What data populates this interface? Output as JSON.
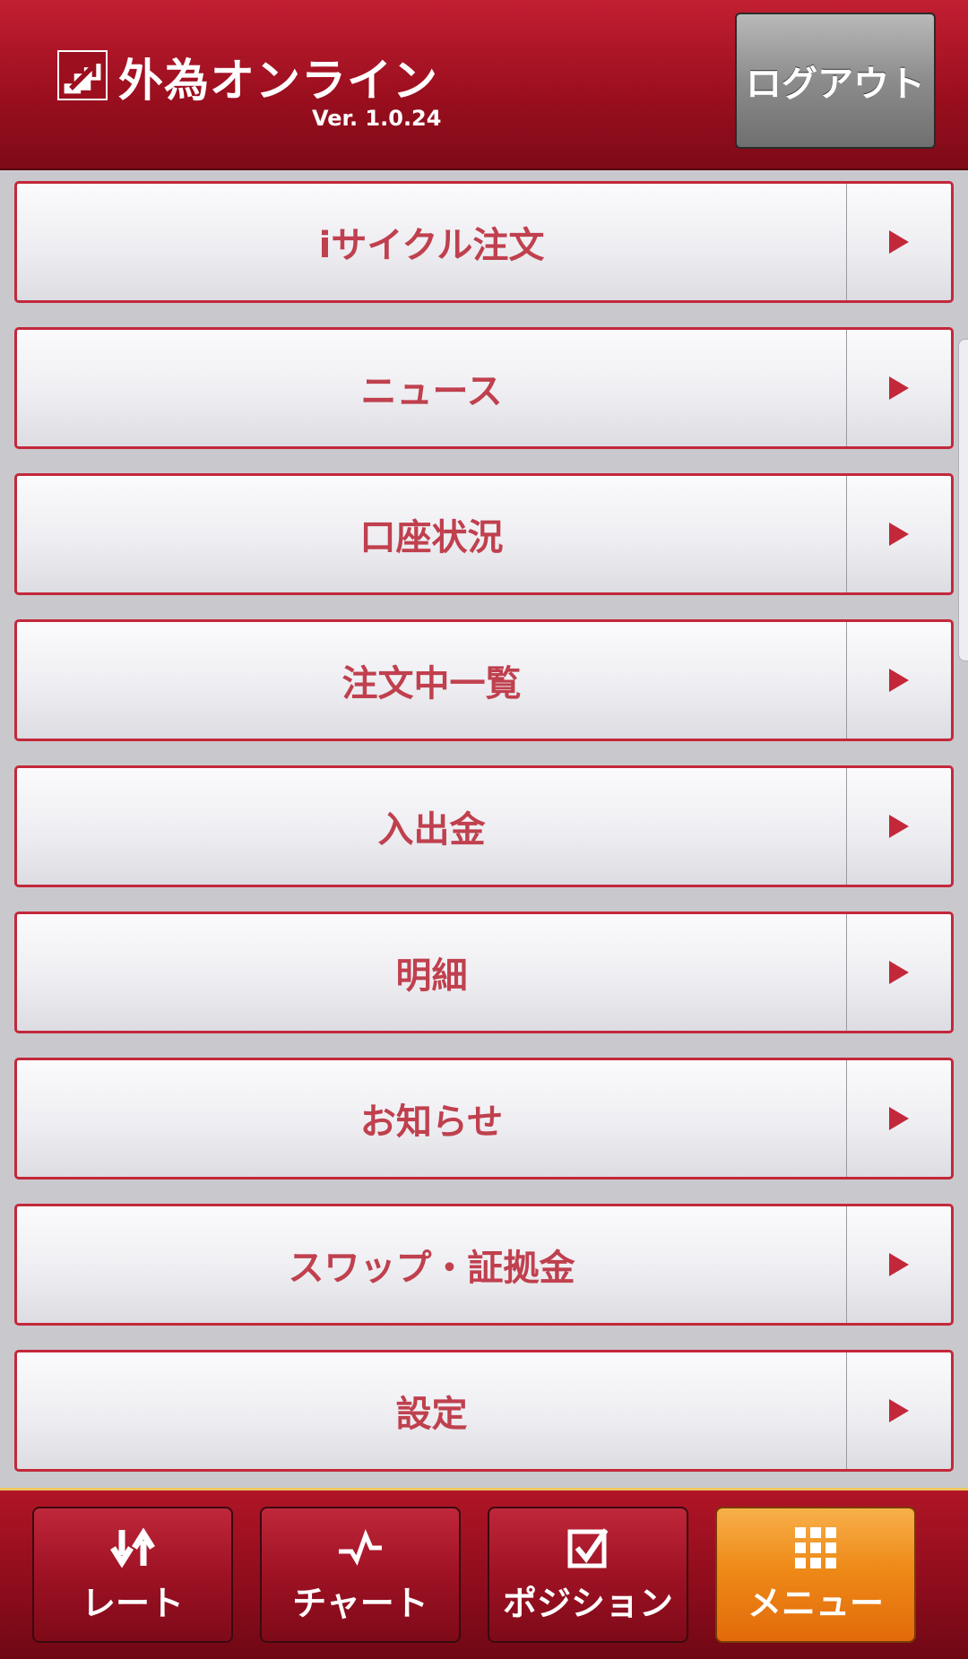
{
  "header": {
    "title": "外為オンライン",
    "version": "Ver. 1.0.24",
    "logout_label": "ログアウト"
  },
  "menu": {
    "items": [
      {
        "label": "iサイクル注文"
      },
      {
        "label": "ニュース"
      },
      {
        "label": "口座状況"
      },
      {
        "label": "注文中一覧"
      },
      {
        "label": "入出金"
      },
      {
        "label": "明細"
      },
      {
        "label": "お知らせ"
      },
      {
        "label": "スワップ・証拠金"
      },
      {
        "label": "設定"
      }
    ]
  },
  "tabs": [
    {
      "label": "レート",
      "icon": "rate-arrows-icon",
      "active": false
    },
    {
      "label": "チャート",
      "icon": "chart-line-icon",
      "active": false
    },
    {
      "label": "ポジション",
      "icon": "checkbox-icon",
      "active": false
    },
    {
      "label": "メニュー",
      "icon": "grid-menu-icon",
      "active": true
    }
  ],
  "colors": {
    "brand_red": "#9c0f1f",
    "menu_text": "#c0404e",
    "menu_border": "#c3283a",
    "active_tab": "#ee8a18"
  }
}
